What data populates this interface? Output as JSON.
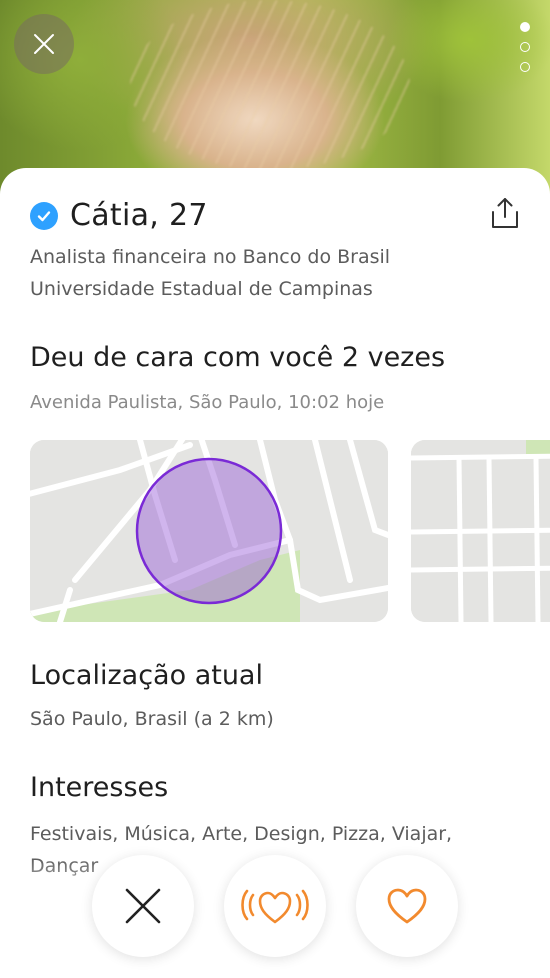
{
  "profile": {
    "name_age": "Cátia, 27",
    "job": "Analista financeira no Banco do Brasil",
    "school": "Universidade Estadual de Campinas"
  },
  "crossed": {
    "title": "Deu de cara com você 2 vezes",
    "detail": "Avenida Paulista, São Paulo, 10:02 hoje"
  },
  "location": {
    "title": "Localização atual",
    "detail": "São Paulo, Brasil (a 2 km)"
  },
  "interests": {
    "title": "Interesses",
    "list": "Festivais, Música, Arte, Design, Pizza, Viajar, Dançar"
  },
  "photo_pager": {
    "count": 3,
    "active": 1
  },
  "colors": {
    "accent": "#f28a2e",
    "verified": "#2ea1ff",
    "area": "#7a2ad6"
  },
  "icons": {
    "close": "close-icon",
    "share": "share-icon",
    "verified": "verified-icon",
    "nope": "x-icon",
    "super": "wave-heart-icon",
    "like": "heart-icon"
  }
}
